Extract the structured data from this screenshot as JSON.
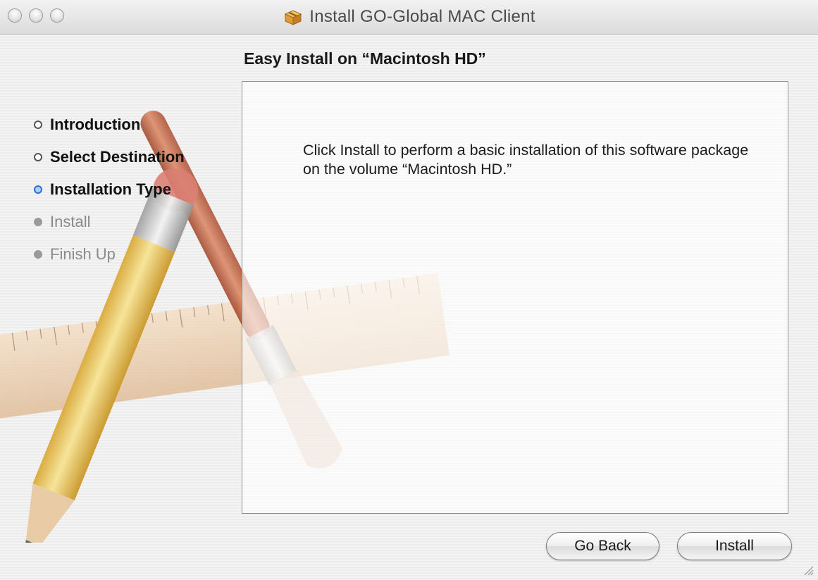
{
  "window": {
    "title": "Install GO-Global MAC Client"
  },
  "main": {
    "heading": "Easy Install on “Macintosh HD”",
    "message": "Click Install to perform a basic installation of this software package on the volume “Macintosh HD.”"
  },
  "sidebar": {
    "steps": [
      {
        "label": "Introduction",
        "state": "done"
      },
      {
        "label": "Select Destination",
        "state": "done"
      },
      {
        "label": "Installation Type",
        "state": "current"
      },
      {
        "label": "Install",
        "state": "todo"
      },
      {
        "label": "Finish Up",
        "state": "todo"
      }
    ]
  },
  "footer": {
    "go_back_label": "Go Back",
    "install_label": "Install"
  },
  "icons": {
    "window_controls": [
      "close-button-icon",
      "minimize-button-icon",
      "zoom-button-icon"
    ],
    "title_icon": "package-installer-icon",
    "background_art": "pencil-ruler-brush-illustration",
    "resize": "resize-grip-icon"
  },
  "colors": {
    "current_step_bullet": "#2f6fd0",
    "pending_step_text": "#8a8a8a"
  }
}
